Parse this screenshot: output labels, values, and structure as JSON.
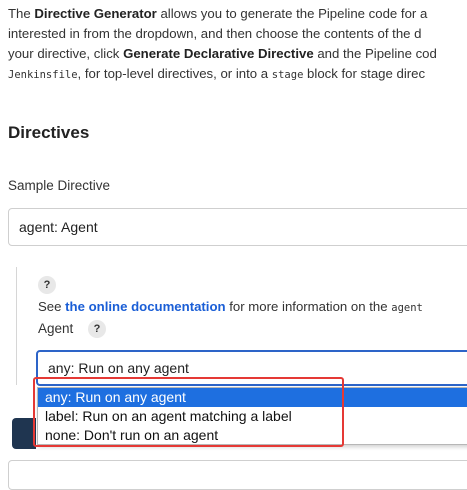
{
  "intro": {
    "line1": {
      "pre": "The ",
      "bold": "Directive Generator",
      "post": " allows you to generate the Pipeline code for a"
    },
    "line2": "interested in from the dropdown, and then choose the contents of the d",
    "line3": {
      "pre": "your directive, click ",
      "bold": "Generate Declarative Directive",
      "post": " and the Pipeline cod"
    },
    "line4": {
      "code1": "Jenkinsfile",
      "mid": ", for top-level directives, or into a ",
      "code2": "stage",
      "post": " block for stage direc"
    }
  },
  "directives": {
    "heading": "Directives",
    "sample_label": "Sample Directive",
    "sample_value": "agent: Agent"
  },
  "agent_panel": {
    "help_text": "?",
    "see_pre": "See ",
    "doc_link": "the online documentation",
    "see_post": " for more information on the ",
    "see_code": "agent",
    "agent_label": "Agent",
    "agent_value": "any: Run on any agent",
    "options": [
      "any: Run on any agent",
      "label: Run on an agent matching a label",
      "none: Don't run on an agent"
    ]
  },
  "colors": {
    "accent": "#1e6fe0",
    "link": "#1a5ed6",
    "annotation": "#e53935",
    "button_dark": "#1f3550"
  }
}
